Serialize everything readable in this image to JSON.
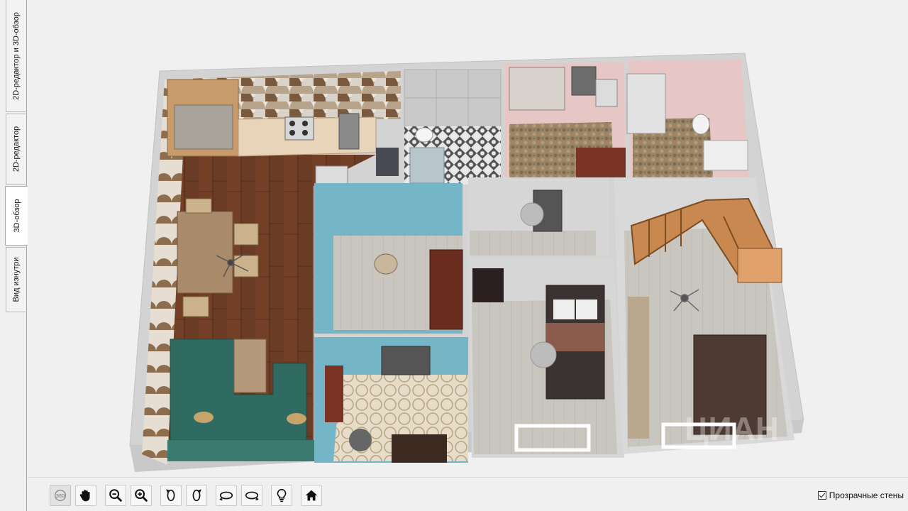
{
  "tabs": [
    {
      "label": "2D-редактор и 3D-обзор",
      "active": false
    },
    {
      "label": "2D-редактор",
      "active": false
    },
    {
      "label": "3D-обзор",
      "active": true
    },
    {
      "label": "Вид изнутри",
      "active": false
    }
  ],
  "scene": {
    "rooms": [
      "kitchen-dining",
      "bathroom",
      "bedroom-small",
      "bedroom-attic",
      "hall",
      "entry-hall",
      "corridor",
      "bedroom",
      "living-room-stairs",
      "lounge"
    ],
    "watermark": "ЦИАН",
    "colors": {
      "wood_floor": "#6a3b25",
      "light_floor": "#c7c3bc",
      "blue_wall": "#74b6c8",
      "pink_wall": "#e7c6c6",
      "sofa_teal": "#2f6b62",
      "wall_gray": "#d6d6d6"
    }
  },
  "toolbar": {
    "buttons": [
      {
        "icon": "rotate-360-icon",
        "label": "360",
        "enabled": false
      },
      {
        "icon": "pan-hand-icon",
        "enabled": true
      },
      {
        "icon": "zoom-out-icon",
        "enabled": true
      },
      {
        "icon": "zoom-in-icon",
        "enabled": true
      },
      {
        "icon": "rotate-left-icon",
        "enabled": true
      },
      {
        "icon": "rotate-right-icon",
        "enabled": true
      },
      {
        "icon": "orbit-left-icon",
        "enabled": true
      },
      {
        "icon": "orbit-right-icon",
        "enabled": true
      },
      {
        "icon": "lightbulb-icon",
        "enabled": true
      },
      {
        "icon": "home-icon",
        "enabled": true
      }
    ],
    "transparent_walls": {
      "label": "Прозрачные стены",
      "checked": true
    }
  }
}
